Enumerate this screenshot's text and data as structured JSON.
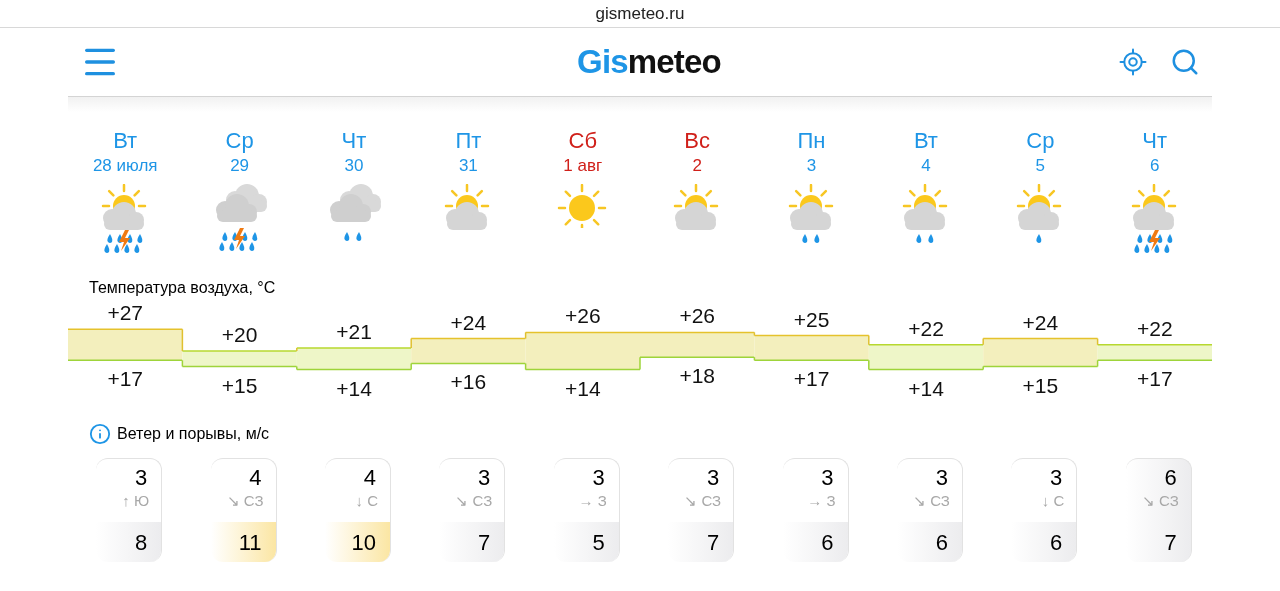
{
  "browser": {
    "address": "gismeteo.ru"
  },
  "header": {
    "logo": {
      "accent": "Gis",
      "rest": "meteo"
    }
  },
  "days": [
    {
      "weekday": "Вт",
      "date": "28 июля",
      "weekend": false,
      "icon": {
        "kind": "partly-cloudy-storm"
      },
      "max": "+27",
      "min": "+17",
      "wind": {
        "speed": "3",
        "direction": "↑ Ю",
        "gust": "8",
        "strong": false,
        "shaded": false
      }
    },
    {
      "weekday": "Ср",
      "date": "29",
      "weekend": false,
      "icon": {
        "kind": "cloudy-storm"
      },
      "max": "+20",
      "min": "+15",
      "wind": {
        "speed": "4",
        "direction": "↘ СЗ",
        "gust": "11",
        "strong": true,
        "shaded": false
      }
    },
    {
      "weekday": "Чт",
      "date": "30",
      "weekend": false,
      "icon": {
        "kind": "cloudy-rain"
      },
      "max": "+21",
      "min": "+14",
      "wind": {
        "speed": "4",
        "direction": "↓ С",
        "gust": "10",
        "strong": true,
        "shaded": false
      }
    },
    {
      "weekday": "Пт",
      "date": "31",
      "weekend": false,
      "icon": {
        "kind": "partly-cloudy"
      },
      "max": "+24",
      "min": "+16",
      "wind": {
        "speed": "3",
        "direction": "↘ СЗ",
        "gust": "7",
        "strong": false,
        "shaded": false
      }
    },
    {
      "weekday": "Сб",
      "date": "1 авг",
      "weekend": true,
      "icon": {
        "kind": "sunny"
      },
      "max": "+26",
      "min": "+14",
      "wind": {
        "speed": "3",
        "direction": "→ З",
        "gust": "5",
        "strong": false,
        "shaded": false
      }
    },
    {
      "weekday": "Вс",
      "date": "2",
      "weekend": true,
      "icon": {
        "kind": "partly-cloudy"
      },
      "max": "+26",
      "min": "+18",
      "wind": {
        "speed": "3",
        "direction": "↘ СЗ",
        "gust": "7",
        "strong": false,
        "shaded": false
      }
    },
    {
      "weekday": "Пн",
      "date": "3",
      "weekend": false,
      "icon": {
        "kind": "partly-cloudy-rain"
      },
      "max": "+25",
      "min": "+17",
      "wind": {
        "speed": "3",
        "direction": "→ З",
        "gust": "6",
        "strong": false,
        "shaded": false
      }
    },
    {
      "weekday": "Вт",
      "date": "4",
      "weekend": false,
      "icon": {
        "kind": "partly-cloudy-rain"
      },
      "max": "+22",
      "min": "+14",
      "wind": {
        "speed": "3",
        "direction": "↘ СЗ",
        "gust": "6",
        "strong": false,
        "shaded": false
      }
    },
    {
      "weekday": "Ср",
      "date": "5",
      "weekend": false,
      "icon": {
        "kind": "partly-cloudy-drizzle"
      },
      "max": "+24",
      "min": "+15",
      "wind": {
        "speed": "3",
        "direction": "↓ С",
        "gust": "6",
        "strong": false,
        "shaded": false
      }
    },
    {
      "weekday": "Чт",
      "date": "6",
      "weekend": false,
      "icon": {
        "kind": "partly-cloudy-storm"
      },
      "max": "+22",
      "min": "+17",
      "wind": {
        "speed": "6",
        "direction": "↘ СЗ",
        "gust": "7",
        "strong": false,
        "shaded": true
      }
    }
  ],
  "temperature": {
    "title": "Температура воздуха, °C"
  },
  "wind_section": {
    "title": "Ветер и порывы, м/с"
  }
}
